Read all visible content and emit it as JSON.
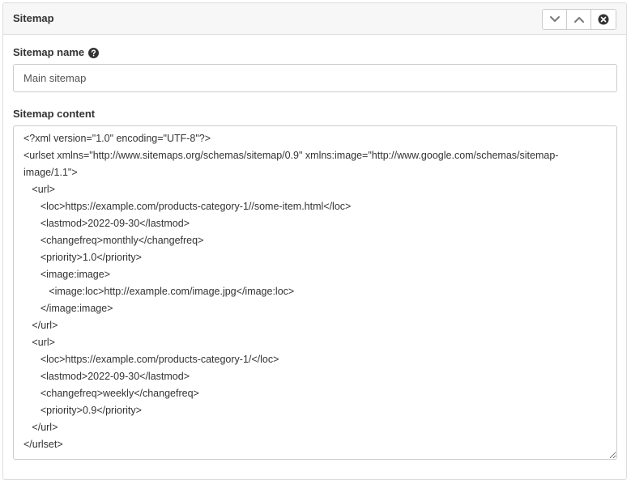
{
  "panel": {
    "title": "Sitemap",
    "buttons": {
      "collapse_icon": "chevron-down-icon",
      "expand_icon": "chevron-up-icon",
      "close_icon": "close-circle-icon"
    }
  },
  "form": {
    "name_label": "Sitemap name",
    "name_help_icon": "question-circle-icon",
    "name_value": "Main sitemap",
    "content_label": "Sitemap content",
    "content_value": "<?xml version=\"1.0\" encoding=\"UTF-8\"?>\n<urlset xmlns=\"http://www.sitemaps.org/schemas/sitemap/0.9\" xmlns:image=\"http://www.google.com/schemas/sitemap-image/1.1\">\n   <url>\n      <loc>https://example.com/products-category-1//some-item.html</loc>\n      <lastmod>2022-09-30</lastmod>\n      <changefreq>monthly</changefreq>\n      <priority>1.0</priority>\n      <image:image>\n         <image:loc>http://example.com/image.jpg</image:loc>\n      </image:image>\n   </url>\n   <url>\n      <loc>https://example.com/products-category-1/</loc>\n      <lastmod>2022-09-30</lastmod>\n      <changefreq>weekly</changefreq>\n      <priority>0.9</priority>\n   </url>\n</urlset>"
  },
  "colors": {
    "border": "#dddddd",
    "header_bg": "#f7f7f7",
    "text": "#333333"
  }
}
